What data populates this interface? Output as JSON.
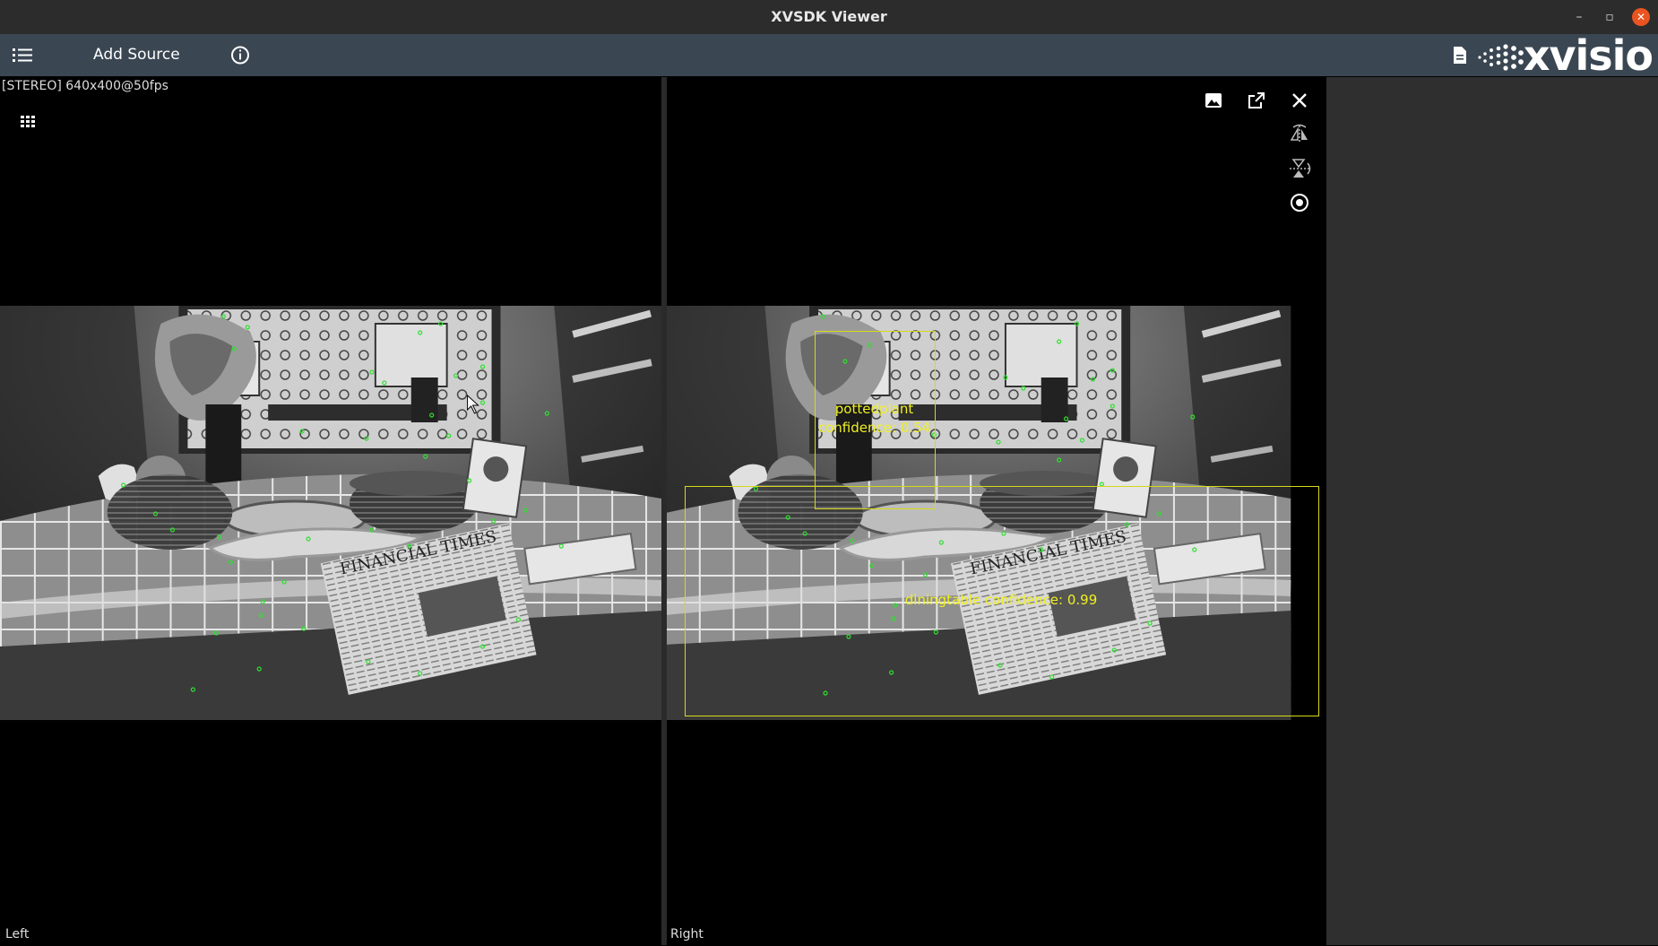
{
  "window": {
    "title": "XVSDK Viewer",
    "controls": {
      "minimize": "–",
      "maximize": "▫",
      "close": "✕"
    }
  },
  "toolbar": {
    "menu_icon": "list-icon",
    "add_source_label": "Add Source",
    "info_icon": "info-icon",
    "doc_icon": "document-icon",
    "logo_text": "xvisio"
  },
  "stream": {
    "info": "[STEREO]  640x400@50fps",
    "grid_icon": "grid-icon"
  },
  "left_view": {
    "label": "Left"
  },
  "right_view": {
    "label": "Right",
    "controls": [
      "image-icon",
      "open-external-icon",
      "close-icon",
      "flip-horizontal-icon",
      "flip-vertical-icon",
      "record-target-icon"
    ],
    "detections": [
      {
        "class": "pottedplant",
        "confidence_text": "confidence: 0.54"
      },
      {
        "class": "diningtable",
        "text": "diningtable confidence: 0.99"
      }
    ]
  },
  "colors": {
    "toolbar_bg": "#3a4652",
    "titlebar_bg": "#2c2c2c",
    "detection": "#d8d818",
    "feature_point": "#2ee02e",
    "close_button": "#e95420"
  }
}
